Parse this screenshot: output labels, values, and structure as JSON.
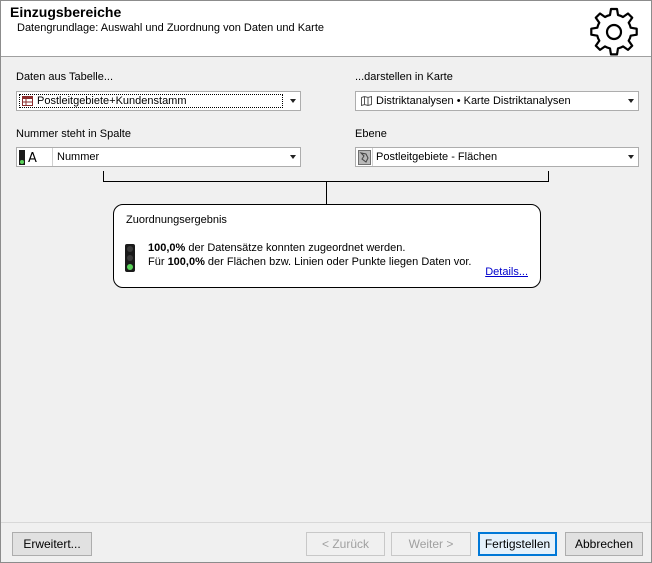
{
  "header": {
    "title": "Einzugsbereiche",
    "subtitle": "Datengrundlage: Auswahl und Zuordnung von Daten und Karte",
    "icon": "gear-icon"
  },
  "left": {
    "table_label": "Daten aus Tabelle...",
    "table_value": "Postleitgebiete+Kundenstamm",
    "column_label": "Nummer steht in Spalte",
    "column_value": "Nummer"
  },
  "right": {
    "map_label": "...darstellen in Karte",
    "map_value": "Distriktanalysen • Karte Distriktanalysen",
    "layer_label": "Ebene",
    "layer_value": "Postleitgebiete - Flächen"
  },
  "result": {
    "title": "Zuordnungsergebnis",
    "line1_pct": "100,0%",
    "line1_rest": " der Datensätze konnten zugeordnet werden.",
    "line2_pre": "Für ",
    "line2_pct": "100,0%",
    "line2_rest": " der Flächen bzw. Linien oder Punkte liegen Daten vor.",
    "details_link": "Details...",
    "status_color": "#5ad35a"
  },
  "buttons": {
    "advanced": "Erweitert...",
    "back": "< Zurück",
    "next": "Weiter >",
    "finish": "Fertigstellen",
    "cancel": "Abbrechen"
  }
}
